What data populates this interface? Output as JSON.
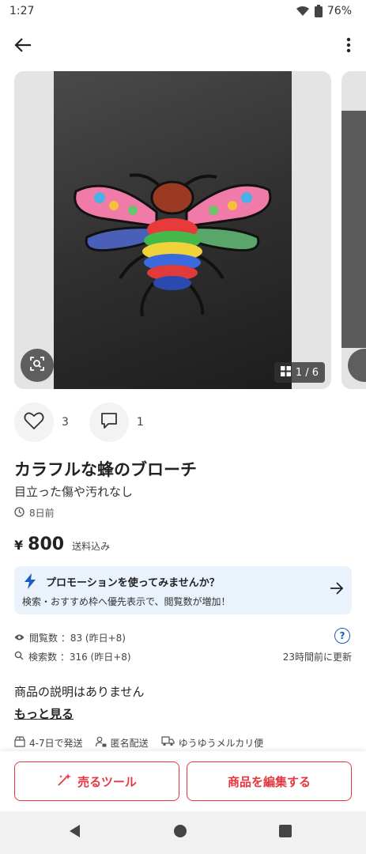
{
  "status_bar": {
    "time": "1:27",
    "battery": "76%"
  },
  "icons": {
    "back": "arrow-left-icon",
    "more": "more-vert-icon",
    "lens": "image-search-icon",
    "like": "heart-icon",
    "comment": "comment-icon"
  },
  "gallery": {
    "counter": "1 / 6"
  },
  "actions": {
    "likes": "3",
    "comments": "1"
  },
  "item": {
    "title": "カラフルな蜂のブローチ",
    "condition": "目立った傷や汚れなし",
    "posted": "8日前",
    "price_symbol": "¥",
    "price": "800",
    "price_note": "送料込み"
  },
  "promo": {
    "title": "プロモーションを使ってみませんか？",
    "subtitle": "検索・おすすめ枠へ優先表示で、閲覧数が増加！"
  },
  "stats": {
    "views": "閲覧数 ：83 (昨日+8)",
    "searches": "検索数 ：316 (昨日+8)",
    "updated": "23時間前に更新",
    "help": "?"
  },
  "description": {
    "text": "商品の説明はありません",
    "more_link": "もっと見る"
  },
  "shipping": {
    "days": "4-7日で発送",
    "anonymous": "匿名配送",
    "method": "ゆうゆうメルカリ便"
  },
  "bottom_actions": {
    "sell_tools": "売るツール",
    "edit_item": "商品を編集する"
  },
  "colors": {
    "accent": "#e8353f",
    "link_blue": "#1d5bbf",
    "promo_bg": "#eaf3fc"
  }
}
